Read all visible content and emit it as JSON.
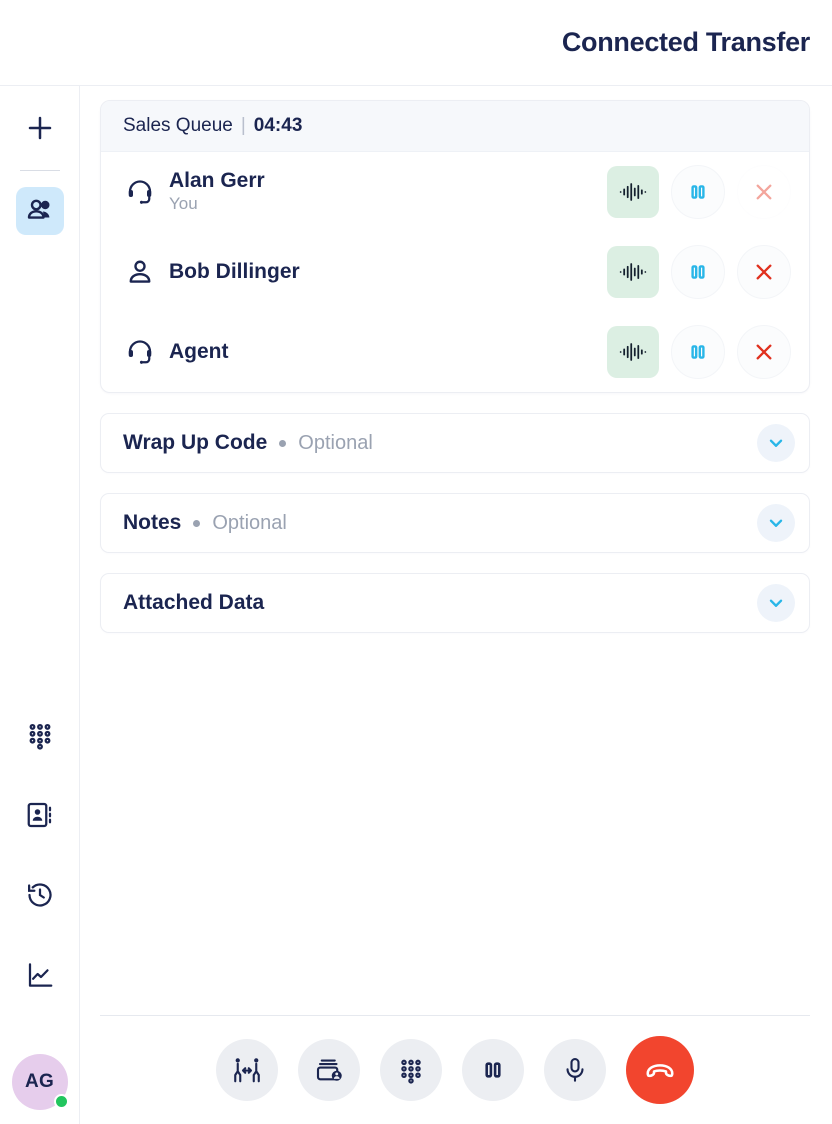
{
  "header": {
    "title": "Connected Transfer"
  },
  "sidebar": {
    "add_label": "Add call",
    "items": [
      {
        "name": "participants",
        "label": "Participants",
        "icon": "people-icon",
        "active": true
      },
      {
        "name": "dialpad",
        "label": "Dialpad",
        "icon": "dialpad-icon",
        "active": false
      },
      {
        "name": "contacts",
        "label": "Contacts",
        "icon": "contacts-book-icon",
        "active": false
      },
      {
        "name": "history",
        "label": "History",
        "icon": "history-clock-icon",
        "active": false
      },
      {
        "name": "analytics",
        "label": "Analytics",
        "icon": "line-chart-icon",
        "active": false
      }
    ],
    "user": {
      "initials": "AG",
      "status": "online",
      "avatar_color": "#e6cdec",
      "status_color": "#22c55e"
    }
  },
  "call": {
    "queue_name": "Sales Queue",
    "separator": "|",
    "timer": "04:43",
    "participants": [
      {
        "name": "Alan Gerr",
        "subtitle": "You",
        "icon": "headset-icon",
        "waveform_label": "Audio level",
        "hold_label": "Hold",
        "remove_label": "Remove",
        "remove_state": "disabled"
      },
      {
        "name": "Bob Dillinger",
        "subtitle": "",
        "icon": "person-icon",
        "waveform_label": "Audio level",
        "hold_label": "Hold",
        "remove_label": "Remove",
        "remove_state": "enabled"
      },
      {
        "name": "Agent",
        "subtitle": "",
        "icon": "headset-icon",
        "waveform_label": "Audio level",
        "hold_label": "Hold",
        "remove_label": "Remove",
        "remove_state": "enabled"
      }
    ]
  },
  "panels": [
    {
      "label": "Wrap Up Code",
      "optional": "Optional",
      "has_optional": true,
      "expanded": false
    },
    {
      "label": "Notes",
      "optional": "Optional",
      "has_optional": true,
      "expanded": false
    },
    {
      "label": "Attached Data",
      "optional": "",
      "has_optional": false,
      "expanded": false
    }
  ],
  "toolbar": [
    {
      "name": "transfer",
      "label": "Transfer",
      "icon": "transfer-people-icon",
      "variant": "default"
    },
    {
      "name": "warm-transfer",
      "label": "Warm Transfer",
      "icon": "card-person-icon",
      "variant": "default"
    },
    {
      "name": "dialpad",
      "label": "Dialpad",
      "icon": "dialpad-icon",
      "variant": "default"
    },
    {
      "name": "hold",
      "label": "Hold",
      "icon": "pause-icon",
      "variant": "default"
    },
    {
      "name": "mute",
      "label": "Mute",
      "icon": "microphone-icon",
      "variant": "default"
    },
    {
      "name": "hangup",
      "label": "End Call",
      "icon": "phone-hangup-icon",
      "variant": "danger"
    }
  ],
  "colors": {
    "navy": "#1b2550",
    "cyan": "#29b6e8",
    "red": "#e0301e",
    "hangup_red": "#f2452e",
    "mint": "#dcefe3",
    "active_blue": "#cfe9fb",
    "muted": "#9aa2b1"
  }
}
